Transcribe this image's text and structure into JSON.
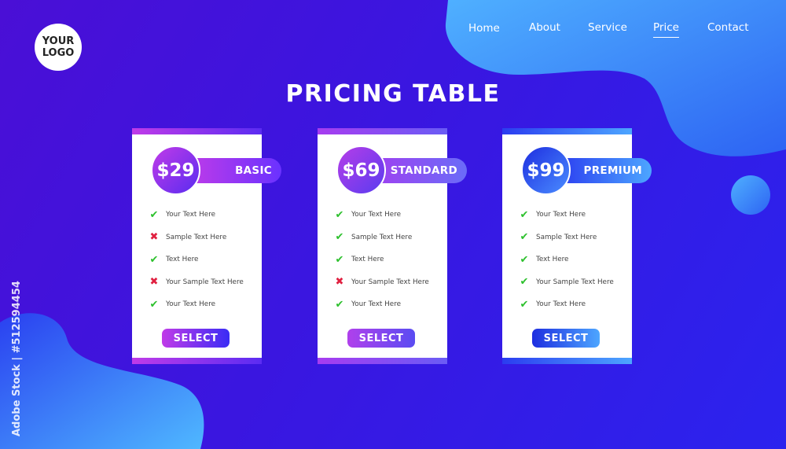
{
  "logo": {
    "text": "YOUR\nLOGO"
  },
  "nav": [
    {
      "label": "Home",
      "active": false
    },
    {
      "label": "About",
      "active": false
    },
    {
      "label": "Service",
      "active": false
    },
    {
      "label": "Price",
      "active": true
    },
    {
      "label": "Contact",
      "active": false
    }
  ],
  "title": "PRICING TABLE",
  "plans": [
    {
      "price": "$29",
      "name": "BASIC",
      "select_label": "SELECT",
      "features": [
        {
          "text": "Your Text Here",
          "included": true
        },
        {
          "text": "Sample Text Here",
          "included": false
        },
        {
          "text": "Text Here",
          "included": true
        },
        {
          "text": "Your Sample Text Here",
          "included": false
        },
        {
          "text": "Your Text Here",
          "included": true
        }
      ]
    },
    {
      "price": "$69",
      "name": "STANDARD",
      "select_label": "SELECT",
      "features": [
        {
          "text": "Your Text Here",
          "included": true
        },
        {
          "text": "Sample Text Here",
          "included": true
        },
        {
          "text": "Text Here",
          "included": true
        },
        {
          "text": "Your Sample Text Here",
          "included": false
        },
        {
          "text": "Your Text Here",
          "included": true
        }
      ]
    },
    {
      "price": "$99",
      "name": "PREMIUM",
      "select_label": "SELECT",
      "features": [
        {
          "text": "Your Text Here",
          "included": true
        },
        {
          "text": "Sample Text Here",
          "included": true
        },
        {
          "text": "Text Here",
          "included": true
        },
        {
          "text": "Your Sample Text Here",
          "included": true
        },
        {
          "text": "Your Text Here",
          "included": true
        }
      ]
    }
  ],
  "watermark": "Adobe Stock | #512594454",
  "colors": {
    "background": "#3a16e0",
    "magenta": "#c03be8",
    "violet": "#7a2ff0",
    "blue": "#2b3cf0",
    "light_blue": "#4da6ff",
    "check": "#2cc02c",
    "cross": "#e02040"
  }
}
